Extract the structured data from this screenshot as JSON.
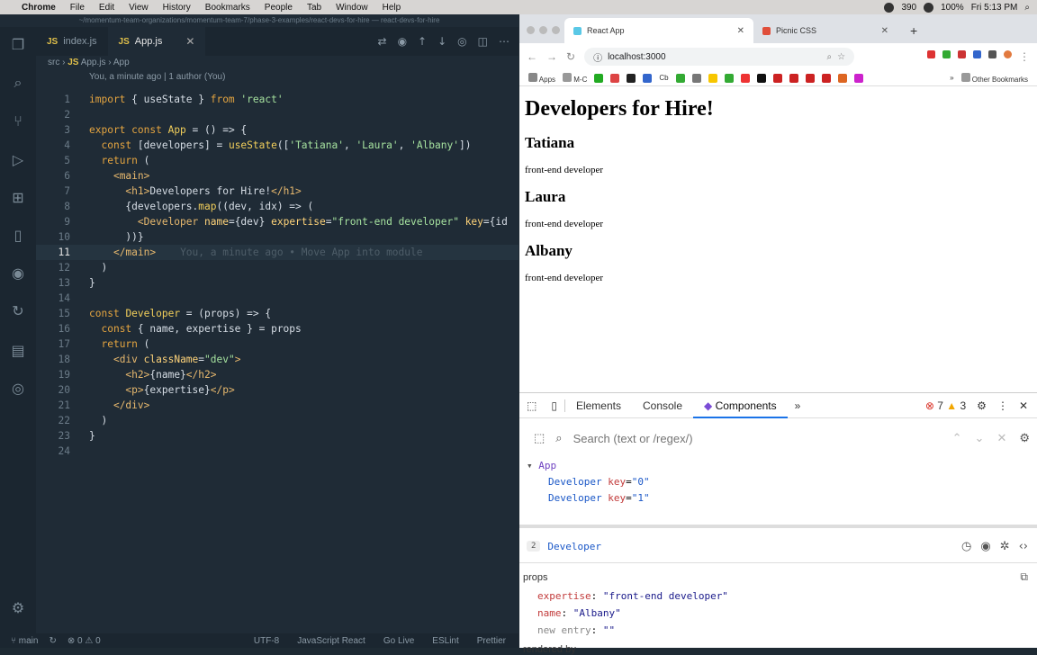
{
  "menubar": {
    "items": [
      "Chrome",
      "File",
      "Edit",
      "View",
      "History",
      "Bookmarks",
      "People",
      "Tab",
      "Window",
      "Help"
    ],
    "battery": "100%",
    "clock": "Fri 5:13 PM",
    "count": "390"
  },
  "vscode": {
    "title": "~/momentum-team-organizations/momentum-team-7/phase-3-examples/react-devs-for-hire — react-devs-for-hire",
    "tabs": [
      {
        "label": "index.js"
      },
      {
        "label": "App.js"
      }
    ],
    "crumb_src": "src",
    "crumb_file": "App.js",
    "crumb_symbol": "App",
    "blame": "You, a minute ago | 1 author (You)",
    "ghost": "You, a minute ago • Move App into module",
    "status": {
      "branch": "main",
      "problems": "⊗ 0 ⚠ 0",
      "encoding": "UTF-8",
      "language": "JavaScript React",
      "golive": "Go Live",
      "eslint": "ESLint",
      "prettier": "Prettier"
    }
  },
  "chrome": {
    "tabs": [
      {
        "label": "React App"
      },
      {
        "label": "Picnic CSS"
      }
    ],
    "url": "localhost:3000",
    "bookmarks": {
      "apps": "Apps",
      "mc": "M-C",
      "cb": "Cb",
      "other": "Other Bookmarks"
    },
    "page": {
      "title": "Developers for Hire!",
      "developers": [
        {
          "name": "Tatiana",
          "expertise": "front-end developer"
        },
        {
          "name": "Laura",
          "expertise": "front-end developer"
        },
        {
          "name": "Albany",
          "expertise": "front-end developer"
        }
      ]
    }
  },
  "devtools": {
    "tabs": [
      "Elements",
      "Console",
      "Components"
    ],
    "errors": "7",
    "warnings": "3",
    "search_placeholder": "Search (text or /regex/)",
    "tree": {
      "root": "App",
      "children": [
        {
          "name": "Developer",
          "key": "0"
        },
        {
          "name": "Developer",
          "key": "1"
        }
      ]
    },
    "selected": {
      "badge": "2",
      "name": "Developer"
    },
    "props_title": "props",
    "props": [
      {
        "k": "expertise",
        "v": "\"front-end developer\""
      },
      {
        "k": "name",
        "v": "\"Albany\""
      },
      {
        "k": "new entry",
        "v": "\"\""
      }
    ],
    "rendered_by": "rendered by"
  }
}
